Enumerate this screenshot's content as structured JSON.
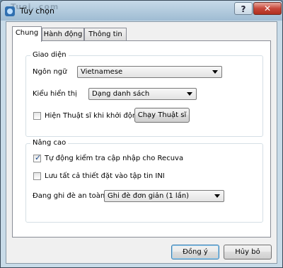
{
  "window": {
    "title": "Tùy chọn",
    "watermark": "Tuoi..com",
    "help_label": "?",
    "close_label": "✕"
  },
  "tabs": [
    {
      "label": "Chung",
      "active": true
    },
    {
      "label": "Hành động",
      "active": false
    },
    {
      "label": "Thông tin",
      "active": false
    }
  ],
  "interface_group": {
    "title": "Giao diện",
    "language_label": "Ngôn ngữ",
    "language_value": "Vietnamese",
    "view_label": "Kiểu hiển thị",
    "view_value": "Dạng danh sách",
    "wizard_checkbox_label": "Hiện Thuật sĩ khi khởi động",
    "wizard_checked": false,
    "run_wizard_button": "Chạy Thuật sĩ"
  },
  "advanced_group": {
    "title": "Nâng cao",
    "auto_update_label": "Tự động kiểm tra cập nhập cho Recuva",
    "auto_update_checked": true,
    "save_ini_label": "Lưu tất cả thiết đặt vào tập tin INI",
    "save_ini_checked": false,
    "secure_overwrite_label": "Đang ghi đè an toàn",
    "secure_overwrite_value": "Ghi đè đơn giản (1 lần)"
  },
  "footer": {
    "ok_button": "Đồng ý",
    "cancel_button": "Hủy bỏ"
  },
  "icons": {
    "app": "recuva-app-icon",
    "check": "checkmark-icon",
    "dropdown": "chevron-down-icon"
  },
  "colors": {
    "title_bar": "#a9c4d8",
    "close_button": "#c7473a",
    "default_button_border": "#3c7fb1"
  }
}
